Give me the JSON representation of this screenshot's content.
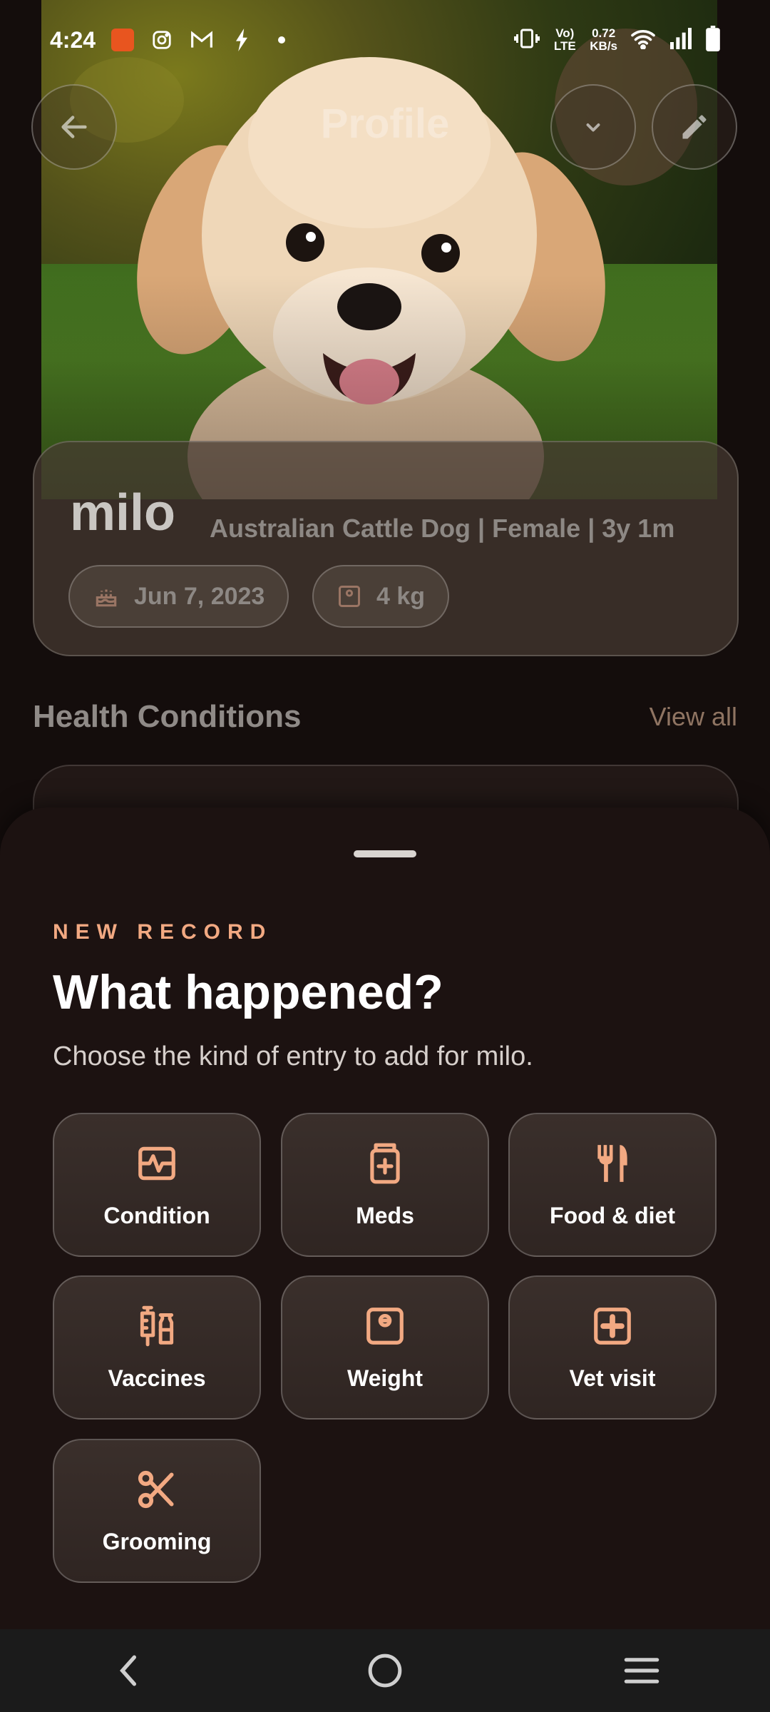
{
  "status_bar": {
    "time": "4:24",
    "net_speed_value": "0.72",
    "net_speed_unit": "KB/s",
    "network": "Vo) LTE"
  },
  "profile": {
    "title": "Profile",
    "pet_name": "milo",
    "pet_meta": "Australian Cattle Dog | Female | 3y 1m",
    "birthday": "Jun 7, 2023",
    "weight": "4 kg"
  },
  "health": {
    "title": "Health Conditions",
    "view_all": "View all"
  },
  "sheet": {
    "eyebrow": "NEW RECORD",
    "headline": "What happened?",
    "subline": "Choose the kind of entry to add for milo.",
    "options": [
      {
        "label": "Condition",
        "icon": "pulse-icon"
      },
      {
        "label": "Meds",
        "icon": "medicine-bottle-icon"
      },
      {
        "label": "Food & diet",
        "icon": "fork-knife-icon"
      },
      {
        "label": "Vaccines",
        "icon": "syringe-vial-icon"
      },
      {
        "label": "Weight",
        "icon": "scale-icon"
      },
      {
        "label": "Vet visit",
        "icon": "medical-kit-icon"
      },
      {
        "label": "Grooming",
        "icon": "scissors-icon"
      }
    ]
  },
  "colors": {
    "accent": "#f2a982",
    "sheet_bg": "#1c1211",
    "tile_bg": "#352a27"
  }
}
